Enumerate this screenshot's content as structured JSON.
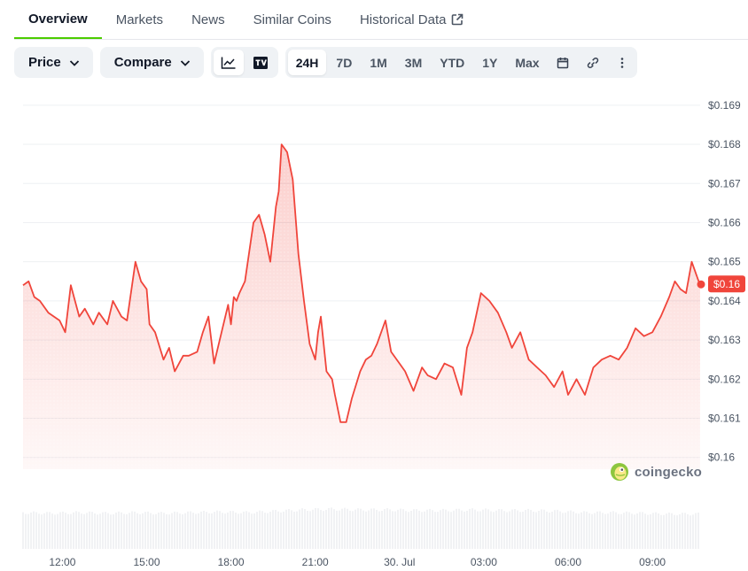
{
  "tabs": [
    {
      "label": "Overview",
      "active": true
    },
    {
      "label": "Markets",
      "active": false
    },
    {
      "label": "News",
      "active": false
    },
    {
      "label": "Similar Coins",
      "active": false
    },
    {
      "label": "Historical Data",
      "active": false
    }
  ],
  "toolbar": {
    "price_label": "Price",
    "compare_label": "Compare",
    "ranges": [
      "24H",
      "7D",
      "1M",
      "3M",
      "YTD",
      "1Y",
      "Max"
    ],
    "active_range": "24H",
    "chart_mode": "line"
  },
  "watermark": "coingecko",
  "colors": {
    "line": "#f0453b",
    "accent_tab": "#4bcc00",
    "badge": "#f0453b",
    "grid": "#eef0f3"
  },
  "chart_data": {
    "type": "area",
    "title": "",
    "xlabel": "",
    "ylabel": "",
    "y_axis_side": "right",
    "ylim": [
      0.1597,
      0.1692
    ],
    "yticks": [
      0.16,
      0.161,
      0.162,
      0.163,
      0.164,
      0.165,
      0.166,
      0.167,
      0.168,
      0.169
    ],
    "ytick_labels": [
      "$0.16",
      "$0.161",
      "$0.162",
      "$0.163",
      "$0.164",
      "$0.165",
      "$0.166",
      "$0.167",
      "$0.168",
      "$0.169"
    ],
    "xlim": [
      10.6,
      34.7
    ],
    "xticks": [
      12,
      15,
      18,
      21,
      24,
      27,
      30,
      33
    ],
    "xtick_labels": [
      "12:00",
      "15:00",
      "18:00",
      "21:00",
      "30. Jul",
      "03:00",
      "06:00",
      "09:00"
    ],
    "current_price_label": "$0.16",
    "grid": true,
    "series": [
      {
        "x": [
          10.6,
          10.8,
          11.0,
          11.2,
          11.5,
          11.9,
          12.1,
          12.3,
          12.6,
          12.8,
          13.1,
          13.3,
          13.6,
          13.8,
          14.1,
          14.3,
          14.6,
          14.8,
          15.0,
          15.1,
          15.3,
          15.6,
          15.8,
          16.0,
          16.3,
          16.5,
          16.8,
          17.0,
          17.2,
          17.4,
          17.6,
          17.9,
          18.0,
          18.1,
          18.2,
          18.3,
          18.5,
          18.8,
          19.0,
          19.2,
          19.4,
          19.6,
          19.7,
          19.8,
          20.0,
          20.2,
          20.4,
          20.6,
          20.8,
          21.0,
          21.1,
          21.2,
          21.4,
          21.6,
          21.7,
          21.9,
          22.1,
          22.3,
          22.6,
          22.8,
          23.0,
          23.2,
          23.5,
          23.7,
          24.0,
          24.2,
          24.5,
          24.8,
          25.0,
          25.3,
          25.6,
          25.9,
          26.2,
          26.4,
          26.6,
          26.9,
          27.2,
          27.5,
          27.8,
          28.0,
          28.3,
          28.6,
          28.9,
          29.2,
          29.5,
          29.8,
          30.0,
          30.3,
          30.6,
          30.9,
          31.2,
          31.5,
          31.8,
          32.1,
          32.4,
          32.7,
          33.0,
          33.3,
          33.6,
          33.8,
          34.0,
          34.2,
          34.4,
          34.6,
          34.7
        ],
        "y": [
          0.1644,
          0.1645,
          0.1641,
          0.164,
          0.1637,
          0.1635,
          0.1632,
          0.1644,
          0.1636,
          0.1638,
          0.1634,
          0.1637,
          0.1634,
          0.164,
          0.1636,
          0.1635,
          0.165,
          0.1645,
          0.1643,
          0.1634,
          0.1632,
          0.1625,
          0.1628,
          0.1622,
          0.1626,
          0.1626,
          0.1627,
          0.1632,
          0.1636,
          0.1624,
          0.163,
          0.1639,
          0.1634,
          0.1641,
          0.164,
          0.1642,
          0.1645,
          0.166,
          0.1662,
          0.1657,
          0.165,
          0.1664,
          0.1668,
          0.168,
          0.1678,
          0.1671,
          0.1652,
          0.164,
          0.1629,
          0.1625,
          0.1632,
          0.1636,
          0.1622,
          0.162,
          0.1616,
          0.1609,
          0.1609,
          0.1615,
          0.1622,
          0.1625,
          0.1626,
          0.1629,
          0.1635,
          0.1627,
          0.1624,
          0.1622,
          0.1617,
          0.1623,
          0.1621,
          0.162,
          0.1624,
          0.1623,
          0.1616,
          0.1628,
          0.1632,
          0.1642,
          0.164,
          0.1637,
          0.1632,
          0.1628,
          0.1632,
          0.1625,
          0.1623,
          0.1621,
          0.1618,
          0.1622,
          0.1616,
          0.162,
          0.1616,
          0.1623,
          0.1625,
          0.1626,
          0.1625,
          0.1628,
          0.1633,
          0.1631,
          0.1632,
          0.1636,
          0.1641,
          0.1645,
          0.1643,
          0.1642,
          0.165,
          0.1646,
          0.1644
        ]
      }
    ],
    "volume": {
      "x": [
        10.6,
        11.6,
        12.6,
        13.6,
        14.6,
        15.6,
        16.6,
        17.6,
        18.6,
        19.6,
        20.6,
        21.6,
        22.6,
        23.6,
        24.6,
        25.6,
        26.6,
        27.6,
        28.6,
        29.6,
        30.6,
        31.6,
        32.6,
        33.6,
        34.7
      ],
      "values": [
        0.52,
        0.51,
        0.52,
        0.51,
        0.52,
        0.51,
        0.52,
        0.53,
        0.52,
        0.54,
        0.56,
        0.57,
        0.56,
        0.56,
        0.55,
        0.55,
        0.56,
        0.55,
        0.55,
        0.54,
        0.52,
        0.52,
        0.51,
        0.5,
        0.5
      ]
    }
  }
}
